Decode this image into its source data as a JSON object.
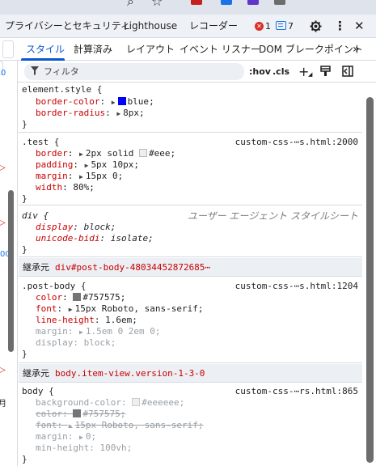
{
  "toolbar1": {
    "tabs": [
      "プライバシーとセキュリティ",
      "Lighthouse",
      "レコーダー"
    ],
    "error_count": "1",
    "message_count": "7"
  },
  "panel_tabs": [
    "スタイル",
    "計算済み",
    "レイアウト",
    "イベント リスナー",
    "DOM ブレークポイント"
  ],
  "filter": {
    "placeholder": "フィルタ",
    "hov": ":hov",
    "cls": ".cls"
  },
  "left_strip": [
    "0",
    "00"
  ],
  "styles": {
    "element_style": {
      "selector": "element.style {",
      "decls": [
        {
          "prop": "border-color",
          "value": "blue",
          "swatch": "#0000ff"
        },
        {
          "prop": "border-radius",
          "value": "8px"
        }
      ],
      "close": "}"
    },
    "test": {
      "selector": ".test {",
      "source": "custom-css-⋯s.html:2000",
      "decls": [
        {
          "prop": "border",
          "value": "2px solid",
          "swatch": "#eeeeee",
          "value2": "#eee;"
        },
        {
          "prop": "padding",
          "value": "5px 10px;"
        },
        {
          "prop": "margin",
          "value": "15px 0;"
        },
        {
          "prop": "width",
          "value": "80%;"
        }
      ],
      "close": "}"
    },
    "div_ua": {
      "selector": "div {",
      "source": "ユーザー エージェント スタイルシート",
      "decls": [
        {
          "prop": "display",
          "value": "block;"
        },
        {
          "prop": "unicode-bidi",
          "value": "isolate;"
        }
      ],
      "close": "}"
    },
    "inherited1": {
      "label": "継承元",
      "link": "div#post-body-48034452872685⋯"
    },
    "post_body": {
      "selector": ".post-body {",
      "source": "custom-css-⋯s.html:1204",
      "decls": [
        {
          "prop": "color",
          "value": "#757575;",
          "swatch": "#757575"
        },
        {
          "prop": "font",
          "value": "15px Roboto, sans-serif;"
        },
        {
          "prop": "line-height",
          "value": "1.6em;"
        },
        {
          "prop": "margin",
          "value": "1.5em 0 2em 0;"
        },
        {
          "prop": "display",
          "value": "block;"
        }
      ],
      "close": "}"
    },
    "inherited2": {
      "label": "継承元",
      "link": "body.item-view.version-1-3-0"
    },
    "body_rule": {
      "selector": "body {",
      "source": "custom-css-⋯rs.html:865",
      "decls": [
        {
          "prop": "background-color",
          "value": "#eeeeee;",
          "swatch": "#eeeeee"
        },
        {
          "prop": "color",
          "value": "#757575;",
          "swatch": "#757575"
        },
        {
          "prop": "font",
          "value": "15px Roboto, sans-serif;"
        },
        {
          "prop": "margin",
          "value": "0;"
        },
        {
          "prop": "min-height",
          "value": "100vh;"
        }
      ],
      "close": "}"
    }
  }
}
